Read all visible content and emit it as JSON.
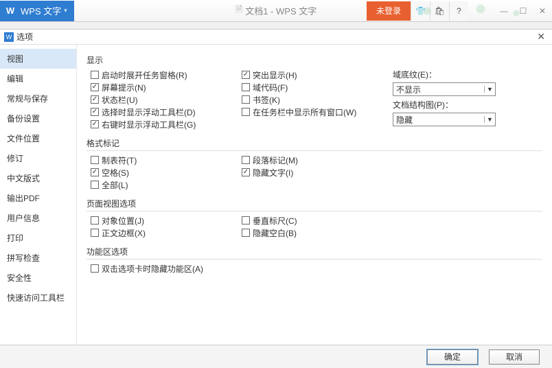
{
  "topbar": {
    "app_label": "WPS 文字",
    "doc_title": "文档1 - WPS 文字",
    "login": "未登录"
  },
  "dialog": {
    "title": "选项",
    "close_glyph": "✕"
  },
  "sidebar": {
    "items": [
      "视图",
      "编辑",
      "常规与保存",
      "备份设置",
      "文件位置",
      "修订",
      "中文版式",
      "输出PDF",
      "用户信息",
      "打印",
      "拼写检查",
      "安全性",
      "快速访问工具栏"
    ],
    "selected_index": 0
  },
  "sections": {
    "display": {
      "title": "显示",
      "col1": [
        {
          "label": "启动时展开任务窗格(R)",
          "checked": false
        },
        {
          "label": "屏幕提示(N)",
          "checked": true
        },
        {
          "label": "状态栏(U)",
          "checked": true
        },
        {
          "label": "选择时显示浮动工具栏(D)",
          "checked": true
        },
        {
          "label": "右键时显示浮动工具栏(G)",
          "checked": true
        }
      ],
      "col2": [
        {
          "label": "突出显示(H)",
          "checked": true
        },
        {
          "label": "域代码(F)",
          "checked": false
        },
        {
          "label": "书签(K)",
          "checked": false
        },
        {
          "label": "在任务栏中显示所有窗口(W)",
          "checked": false
        }
      ],
      "selects": [
        {
          "label": "域底纹(E)：",
          "value": "不显示"
        },
        {
          "label": "文档结构图(P)：",
          "value": "隐藏"
        }
      ]
    },
    "marks": {
      "title": "格式标记",
      "col1": [
        {
          "label": "制表符(T)",
          "checked": false
        },
        {
          "label": "空格(S)",
          "checked": true
        },
        {
          "label": "全部(L)",
          "checked": false
        }
      ],
      "col2": [
        {
          "label": "段落标记(M)",
          "checked": false
        },
        {
          "label": "隐藏文字(I)",
          "checked": true
        }
      ]
    },
    "pageview": {
      "title": "页面视图选项",
      "col1": [
        {
          "label": "对象位置(J)",
          "checked": false
        },
        {
          "label": "正文边框(X)",
          "checked": false
        }
      ],
      "col2": [
        {
          "label": "垂直标尺(C)",
          "checked": false
        },
        {
          "label": "隐藏空白(B)",
          "checked": false
        }
      ]
    },
    "ribbon": {
      "title": "功能区选项",
      "items": [
        {
          "label": "双击选项卡时隐藏功能区(A)",
          "checked": false
        }
      ]
    }
  },
  "footer": {
    "ok": "确定",
    "cancel": "取消"
  }
}
